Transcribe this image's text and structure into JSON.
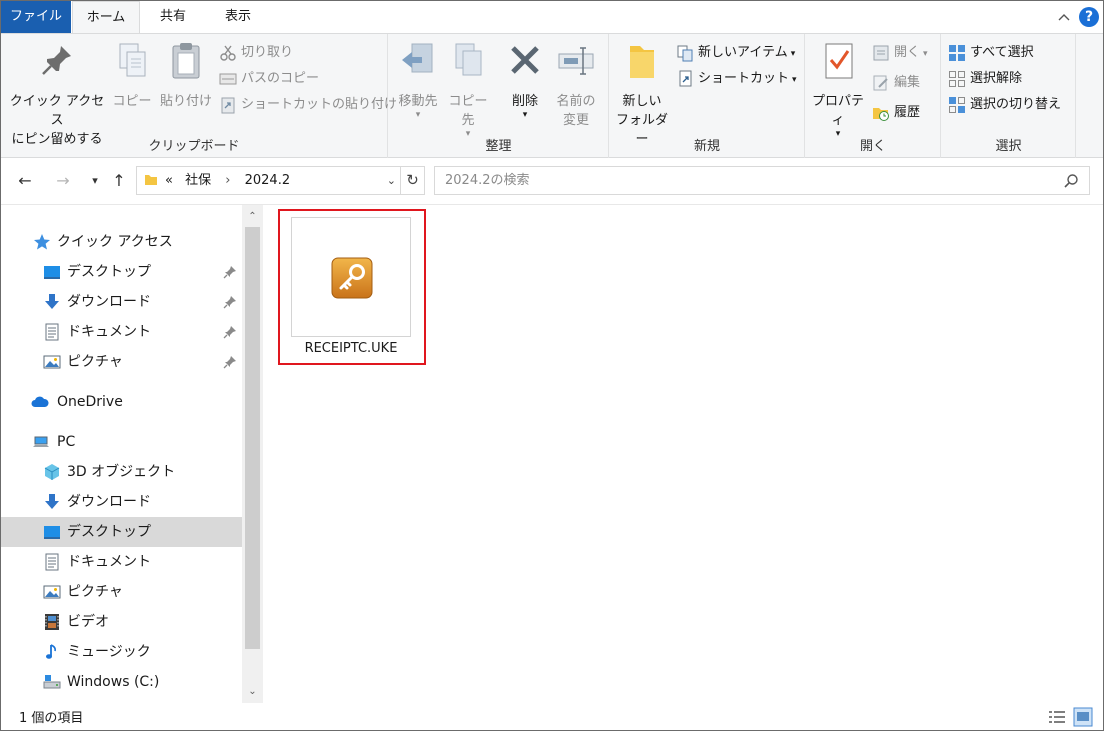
{
  "tabs": {
    "file": "ファイル",
    "home": "ホーム",
    "share": "共有",
    "view": "表示"
  },
  "help_label": "?",
  "ribbon": {
    "clipboard": {
      "group_label": "クリップボード",
      "pin_quick_access_line1": "クイック アクセス",
      "pin_quick_access_line2": "にピン留めする",
      "copy": "コピー",
      "paste": "貼り付け",
      "cut": "切り取り",
      "copy_path": "パスのコピー",
      "paste_shortcut": "ショートカットの貼り付け"
    },
    "organize": {
      "group_label": "整理",
      "move_to": "移動先",
      "copy_to": "コピー先",
      "delete": "削除",
      "rename_line1": "名前の",
      "rename_line2": "変更"
    },
    "new": {
      "group_label": "新規",
      "new_folder_line1": "新しい",
      "new_folder_line2": "フォルダー",
      "new_item": "新しいアイテム",
      "shortcut": "ショートカット"
    },
    "open": {
      "group_label": "開く",
      "properties": "プロパティ",
      "open": "開く",
      "edit": "編集",
      "history": "履歴"
    },
    "select": {
      "group_label": "選択",
      "select_all": "すべて選択",
      "select_none": "選択解除",
      "invert_selection": "選択の切り替え"
    }
  },
  "address": {
    "overflow": "«",
    "crumb1": "社保",
    "separator": "›",
    "crumb2": "2024.2"
  },
  "search": {
    "placeholder": "2024.2の検索"
  },
  "nav_pane": {
    "quick_access": "クイック アクセス",
    "qa_desktop": "デスクトップ",
    "qa_downloads": "ダウンロード",
    "qa_documents": "ドキュメント",
    "qa_pictures": "ピクチャ",
    "onedrive": "OneDrive",
    "pc": "PC",
    "pc_3d": "3D オブジェクト",
    "pc_downloads": "ダウンロード",
    "pc_desktop": "デスクトップ",
    "pc_documents": "ドキュメント",
    "pc_pictures": "ピクチャ",
    "pc_videos": "ビデオ",
    "pc_music": "ミュージック",
    "pc_windows": "Windows (C:)"
  },
  "files": [
    {
      "name": "RECEIPTC.UKE",
      "icon": "key-icon"
    }
  ],
  "status": {
    "count_text": "1 個の項目"
  },
  "colors": {
    "file_tab": "#1a5fb0",
    "selection_box": "#e0161e",
    "accent_blue": "#1a6fd6"
  }
}
